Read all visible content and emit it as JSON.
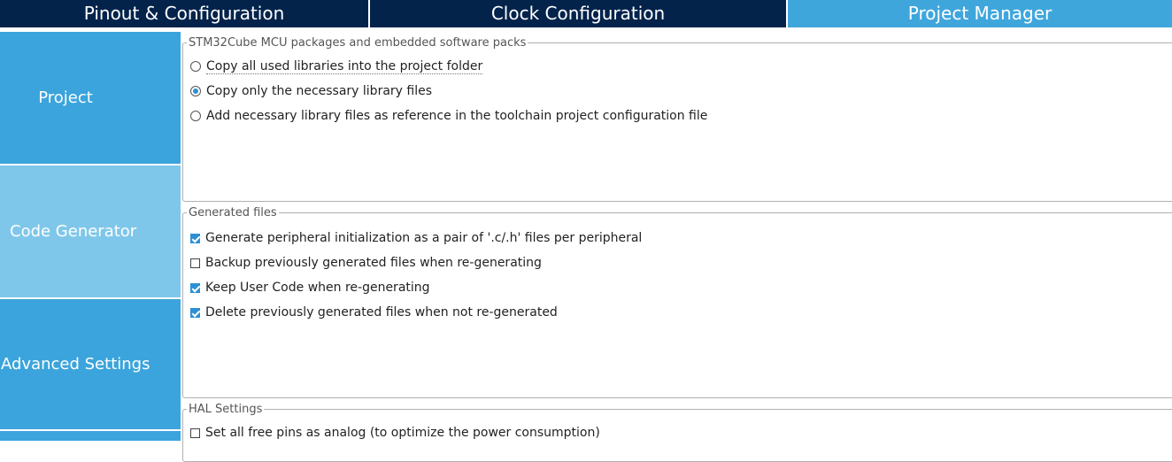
{
  "tabs": [
    {
      "label": "Pinout & Configuration"
    },
    {
      "label": "Clock Configuration"
    },
    {
      "label": "Project Manager"
    }
  ],
  "nav": {
    "items": [
      {
        "label": "Project"
      },
      {
        "label": "Code Generator"
      },
      {
        "label": "Advanced Settings"
      }
    ]
  },
  "packages": {
    "legend": "STM32Cube MCU packages and embedded software packs",
    "options": [
      {
        "label": "Copy all used libraries into the project folder",
        "selected": false
      },
      {
        "label": "Copy only the necessary library files",
        "selected": true
      },
      {
        "label": "Add necessary library files as reference in the toolchain project configuration file",
        "selected": false
      }
    ]
  },
  "generated": {
    "legend": "Generated files",
    "options": [
      {
        "label": "Generate peripheral initialization as a pair of '.c/.h' files per peripheral",
        "checked": true
      },
      {
        "label": "Backup previously generated files when re-generating",
        "checked": false
      },
      {
        "label": "Keep User Code when re-generating",
        "checked": true
      },
      {
        "label": "Delete previously generated files when not re-generated",
        "checked": true
      }
    ]
  },
  "hal": {
    "legend": "HAL Settings",
    "options": [
      {
        "label": "Set all free pins as analog (to optimize the power consumption)",
        "checked": false
      }
    ]
  },
  "colors": {
    "tab_dark": "#03234b",
    "tab_active": "#3fa6dc",
    "nav_dark": "#3ba4dc",
    "nav_selected": "#7fc7ea",
    "accent": "#2d8fd5"
  }
}
